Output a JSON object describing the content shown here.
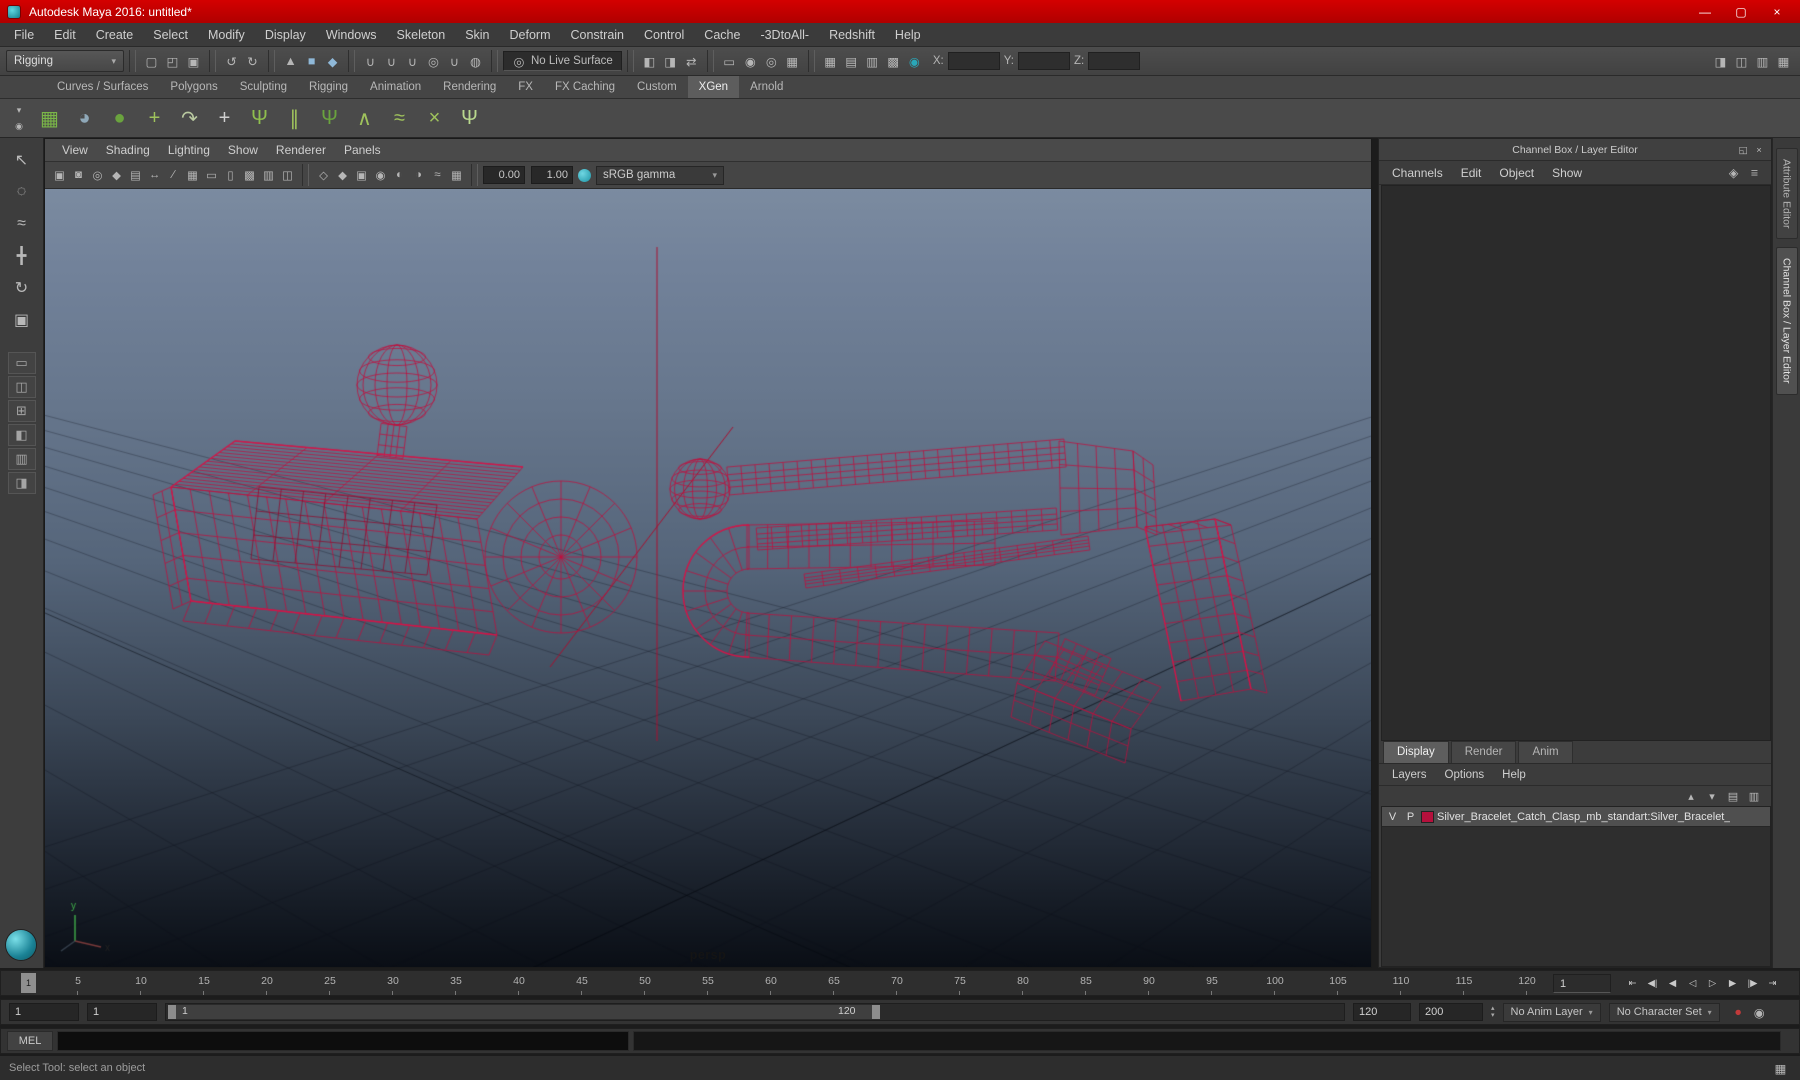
{
  "glyphs": {
    "caret_down": "▾",
    "minimize": "—",
    "maximize": "▢",
    "close": "×"
  },
  "titlebar": {
    "title": "Autodesk Maya 2016: untitled*"
  },
  "menubar": {
    "items": [
      "File",
      "Edit",
      "Create",
      "Select",
      "Modify",
      "Display",
      "Windows",
      "Skeleton",
      "Skin",
      "Deform",
      "Constrain",
      "Control",
      "Cache",
      "-3DtoAll-",
      "Redshift",
      "Help"
    ]
  },
  "statusline": {
    "mode": "Rigging",
    "live_surface": "No Live Surface",
    "file_icons": [
      {
        "name": "new-scene-icon",
        "glyph": "▢"
      },
      {
        "name": "open-scene-icon",
        "glyph": "◰"
      },
      {
        "name": "save-scene-icon",
        "glyph": "▣"
      }
    ],
    "undo_icons": [
      {
        "name": "undo-icon",
        "glyph": "↺"
      },
      {
        "name": "redo-icon",
        "glyph": "↻"
      }
    ],
    "selection_icons": [
      {
        "name": "select-hierarchy-icon",
        "glyph": "▲"
      },
      {
        "name": "select-object-icon",
        "glyph": "■",
        "color": "#8fb8d8"
      },
      {
        "name": "select-component-icon",
        "glyph": "◆",
        "color": "#8fb8d8"
      }
    ],
    "snap_icons": [
      {
        "name": "snap-to-grids-icon",
        "glyph": "∪"
      },
      {
        "name": "snap-to-curves-icon",
        "glyph": "∪"
      },
      {
        "name": "snap-to-points-icon",
        "glyph": "∪"
      },
      {
        "name": "snap-to-projected-center-icon",
        "glyph": "◎"
      },
      {
        "name": "snap-to-view-planes-icon",
        "glyph": "∪"
      },
      {
        "name": "make-live-icon",
        "glyph": "◍"
      }
    ],
    "history_icons": [
      {
        "name": "input-connections-icon",
        "glyph": "◧"
      },
      {
        "name": "output-connections-icon",
        "glyph": "◨"
      },
      {
        "name": "construction-history-icon",
        "glyph": "⇄"
      }
    ],
    "render_icons": [
      {
        "name": "render-view-icon",
        "glyph": "▭"
      },
      {
        "name": "render-current-frame-icon",
        "glyph": "◉"
      },
      {
        "name": "ipr-render-icon",
        "glyph": "◎"
      },
      {
        "name": "render-settings-icon",
        "glyph": "▦"
      }
    ],
    "component_icons": [
      {
        "name": "select-points-icon",
        "glyph": "▦"
      },
      {
        "name": "select-edges-icon",
        "glyph": "▤"
      },
      {
        "name": "select-faces-icon",
        "glyph": "▥"
      },
      {
        "name": "select-uvs-icon",
        "glyph": "▩"
      }
    ],
    "highlight_icon": {
      "name": "selection-highlighting-icon",
      "glyph": "◉"
    },
    "coords": {
      "x_label": "X:",
      "y_label": "Y:",
      "z_label": "Z:",
      "x_value": "",
      "y_value": "",
      "z_value": ""
    },
    "sidebar_icons": [
      {
        "name": "attribute-editor-toggle-icon",
        "glyph": "◨"
      },
      {
        "name": "tool-settings-toggle-icon",
        "glyph": "◫"
      },
      {
        "name": "channel-box-toggle-icon",
        "glyph": "▥"
      },
      {
        "name": "workspace-toggle-icon",
        "glyph": "▦"
      }
    ]
  },
  "shelf": {
    "tabs": [
      "Curves / Surfaces",
      "Polygons",
      "Sculpting",
      "Rigging",
      "Animation",
      "Rendering",
      "FX",
      "FX Caching",
      "Custom",
      "XGen",
      "Arnold"
    ],
    "active_tab": "XGen",
    "menu_icons": [
      {
        "name": "shelf-menu-icon",
        "glyph": "▾"
      },
      {
        "name": "shelf-gear-icon",
        "glyph": "◉"
      }
    ],
    "icons": [
      {
        "name": "xgen-editor-icon",
        "glyph": "▦",
        "color": "#7ab648"
      },
      {
        "name": "xgen-sphere-icon",
        "glyph": "◕",
        "color": "#8fa8b8"
      },
      {
        "name": "xgen-description-icon",
        "glyph": "●",
        "color": "#6aa33e"
      },
      {
        "name": "xgen-add-description-icon",
        "glyph": "+",
        "color": "#9fc25c"
      },
      {
        "name": "xgen-export-curves-icon",
        "glyph": "↷",
        "color": "#b9c9a0"
      },
      {
        "name": "xgen-add-icon",
        "glyph": "+",
        "color": "#cfcfcf"
      },
      {
        "name": "xgen-guides-icon",
        "glyph": "Ψ",
        "color": "#8fbf4e"
      },
      {
        "name": "xgen-comb-icon",
        "glyph": "∥",
        "color": "#9fc25c"
      },
      {
        "name": "xgen-grass-icon",
        "glyph": "Ψ",
        "color": "#6aa33e"
      },
      {
        "name": "xgen-clump-icon",
        "glyph": "∧",
        "color": "#9fc25c"
      },
      {
        "name": "xgen-noise-icon",
        "glyph": "≈",
        "color": "#9fc25c"
      },
      {
        "name": "xgen-cut-icon",
        "glyph": "×",
        "color": "#9fc25c"
      },
      {
        "name": "xgen-groom-icon",
        "glyph": "Ψ",
        "color": "#b9d98e"
      }
    ]
  },
  "toolbox": {
    "tools": [
      {
        "name": "select-tool-icon",
        "glyph": "↖"
      },
      {
        "name": "lasso-tool-icon",
        "glyph": "◌"
      },
      {
        "name": "paint-selection-tool-icon",
        "glyph": "≈"
      },
      {
        "name": "move-tool-icon",
        "glyph": "╋"
      },
      {
        "name": "rotate-tool-icon",
        "glyph": "↻"
      },
      {
        "name": "scale-tool-icon",
        "glyph": "▣"
      }
    ],
    "layouts": [
      {
        "name": "layout-single-pane-icon",
        "glyph": "▭"
      },
      {
        "name": "layout-two-pane-icon",
        "glyph": "◫"
      },
      {
        "name": "layout-four-pane-icon",
        "glyph": "⊞"
      },
      {
        "name": "layout-persp-outliner-icon",
        "glyph": "◧"
      },
      {
        "name": "layout-hypershade-icon",
        "glyph": "▥"
      },
      {
        "name": "layout-persp-graph-icon",
        "glyph": "◨"
      }
    ]
  },
  "viewport": {
    "menus": [
      "View",
      "Shading",
      "Lighting",
      "Show",
      "Renderer",
      "Panels"
    ],
    "toolbar_icons_a": [
      {
        "name": "select-camera-icon",
        "glyph": "▣"
      },
      {
        "name": "lock-camera-icon",
        "glyph": "◙"
      },
      {
        "name": "camera-attributes-icon",
        "glyph": "◎"
      },
      {
        "name": "bookmark-icon",
        "glyph": "◆"
      },
      {
        "name": "image-plane-icon",
        "glyph": "▤"
      },
      {
        "name": "2d-pan-zoom-icon",
        "glyph": "↔"
      },
      {
        "name": "grease-pencil-icon",
        "glyph": "∕"
      },
      {
        "name": "grid-icon",
        "glyph": "▦"
      },
      {
        "name": "film-gate-icon",
        "glyph": "▭"
      },
      {
        "name": "resolution-gate-icon",
        "glyph": "▯"
      },
      {
        "name": "gate-mask-icon",
        "glyph": "▩"
      },
      {
        "name": "field-chart-icon",
        "glyph": "▥"
      },
      {
        "name": "safe-action-icon",
        "glyph": "◫"
      }
    ],
    "toolbar_icons_b": [
      {
        "name": "wireframe-icon",
        "glyph": "◇"
      },
      {
        "name": "shaded-icon",
        "glyph": "◆"
      },
      {
        "name": "textured-icon",
        "glyph": "▣"
      },
      {
        "name": "use-all-lights-icon",
        "glyph": "◉"
      },
      {
        "name": "shadows-icon",
        "glyph": "◐"
      },
      {
        "name": "occlusion-icon",
        "glyph": "◑"
      },
      {
        "name": "motion-blur-icon",
        "glyph": "≈"
      },
      {
        "name": "isolate-select-icon",
        "glyph": "▦"
      }
    ],
    "exposure": "0.00",
    "gamma": "1.00",
    "colorspace": "sRGB gamma",
    "camera_label": "persp"
  },
  "channel_box": {
    "title": "Channel Box / Layer Editor",
    "header_icons": [
      {
        "name": "undock-icon",
        "glyph": "◱"
      },
      {
        "name": "close-icon",
        "glyph": "×"
      }
    ],
    "menus": [
      "Channels",
      "Edit",
      "Object",
      "Show"
    ],
    "menu_icons": [
      {
        "name": "channel-sliders-icon",
        "glyph": "◈"
      },
      {
        "name": "pin-channels-icon",
        "glyph": "≡"
      }
    ],
    "layer_tabs": [
      "Display",
      "Render",
      "Anim"
    ],
    "active_layer_tab": "Display",
    "layer_menus": [
      "Layers",
      "Options",
      "Help"
    ],
    "layer_buttons": [
      {
        "name": "move-layer-up-icon",
        "glyph": "▴"
      },
      {
        "name": "move-layer-down-icon",
        "glyph": "▾"
      },
      {
        "name": "add-empty-layer-icon",
        "glyph": "▤"
      },
      {
        "name": "add-layer-from-selected-icon",
        "glyph": "▥"
      }
    ],
    "layers": [
      {
        "visibility": "V",
        "playback": "P",
        "color": "#b5103c",
        "name": "Silver_Bracelet_Catch_Clasp_mb_standart:Silver_Bracelet_"
      }
    ]
  },
  "side_panel": {
    "active_tab": "Channel Box / Layer Editor",
    "tabs": [
      {
        "name": "attribute-editor-tab",
        "label": "Attribute Editor"
      },
      {
        "name": "channel-box-tab",
        "label": "Channel Box / Layer Editor"
      }
    ]
  },
  "timeline": {
    "ticks": [
      "5",
      "10",
      "15",
      "20",
      "25",
      "30",
      "35",
      "40",
      "45",
      "50",
      "55",
      "60",
      "65",
      "70",
      "75",
      "80",
      "85",
      "90",
      "95",
      "100",
      "105",
      "110",
      "115",
      "120"
    ],
    "playhead_label": "1",
    "current_frame": "1",
    "playback_icons": [
      {
        "name": "go-to-start-icon",
        "glyph": "⇤"
      },
      {
        "name": "step-back-key-icon",
        "glyph": "◀|"
      },
      {
        "name": "step-back-frame-icon",
        "glyph": "◀"
      },
      {
        "name": "play-backwards-icon",
        "glyph": "◁"
      },
      {
        "name": "play-forwards-icon",
        "glyph": "▷"
      },
      {
        "name": "step-forward-frame-icon",
        "glyph": "▶"
      },
      {
        "name": "step-forward-key-icon",
        "glyph": "|▶"
      },
      {
        "name": "go-to-end-icon",
        "glyph": "⇥"
      }
    ]
  },
  "range_slider": {
    "animation_start": "1",
    "playback_start": "1",
    "slider_start_label": "1",
    "slider_end_label": "120",
    "playback_end": "120",
    "animation_end": "200",
    "anim_layer": "No Anim Layer",
    "character_set": "No Character Set",
    "icons": [
      {
        "name": "auto-keyframe-icon",
        "glyph": "●",
        "color": "#c23a3a"
      },
      {
        "name": "animation-preferences-icon",
        "glyph": "◉"
      }
    ]
  },
  "command_line": {
    "label": "MEL"
  },
  "help_line": {
    "text": "Select Tool: select an object",
    "icon": {
      "name": "script-editor-icon",
      "glyph": "▦"
    }
  }
}
